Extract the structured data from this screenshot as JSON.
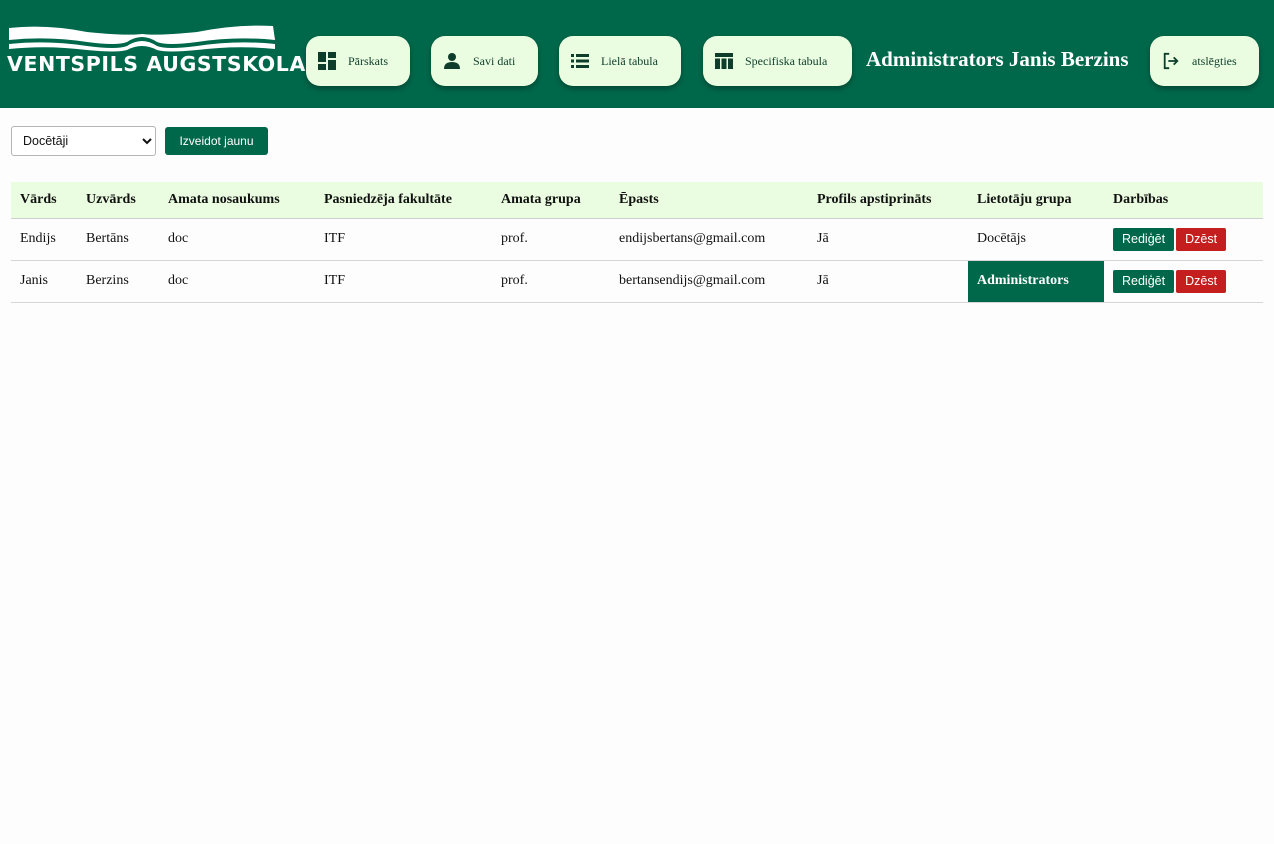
{
  "header": {
    "logo_text": "VENTSPILS AUGSTSKOLA",
    "nav": [
      {
        "label": "Pārskats",
        "icon": "dashboard-icon"
      },
      {
        "label": "Savi dati",
        "icon": "person-icon"
      },
      {
        "label": "Lielā tabula",
        "icon": "list-icon"
      },
      {
        "label": "Specifiska tabula",
        "icon": "table-icon"
      }
    ],
    "user_title": "Administrators Janis Berzins",
    "logout_label": "atslēgties",
    "logout_icon": "logout-icon"
  },
  "toolbar": {
    "select_value": "Docētāji",
    "create_label": "Izveidot jaunu"
  },
  "table": {
    "columns": [
      "Vārds",
      "Uzvārds",
      "Amata nosaukums",
      "Pasniedzēja fakultāte",
      "Amata grupa",
      "Ēpasts",
      "Profils apstiprināts",
      "Lietotāju grupa",
      "Darbības"
    ],
    "rows": [
      [
        "Endijs",
        "Bertāns",
        "doc",
        "ITF",
        "prof.",
        "endijsbertans@gmail.com",
        "Jā",
        "Docētājs"
      ],
      [
        "Janis",
        "Berzins",
        "doc",
        "ITF",
        "prof.",
        "bertansendijs@gmail.com",
        "Jā",
        "Administrators"
      ]
    ],
    "edit_label": "Rediģēt",
    "delete_label": "Dzēst"
  },
  "colors": {
    "brand_green": "#00684a",
    "nav_button_bg": "#eafde0",
    "delete_red": "#c41e1e"
  }
}
